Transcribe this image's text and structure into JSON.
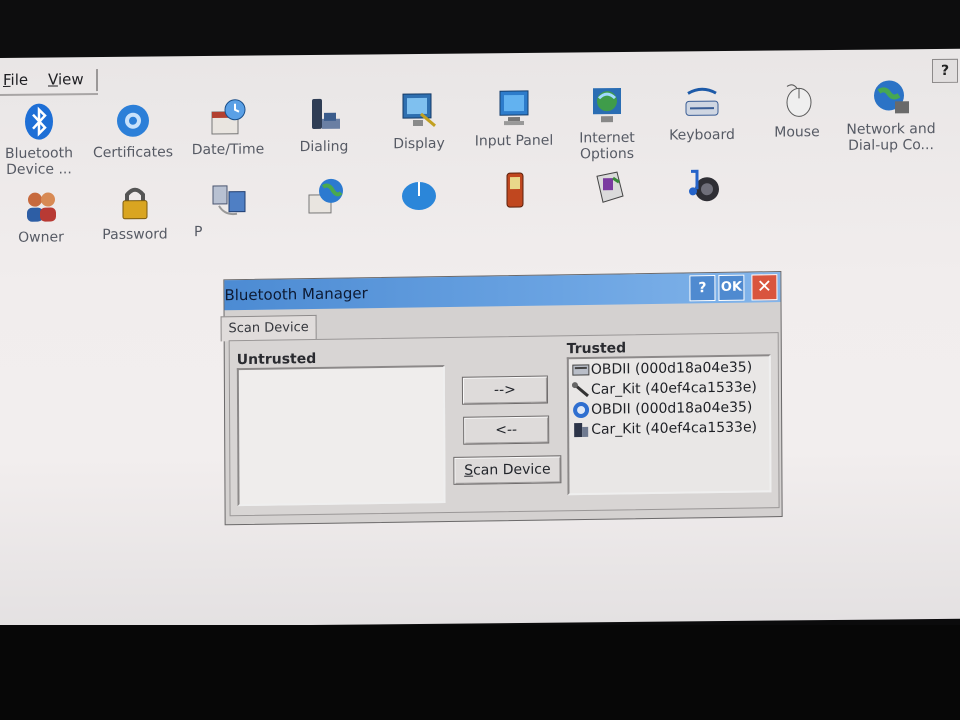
{
  "menubar": {
    "file": "File",
    "view": "View",
    "help_button": "?"
  },
  "control_panel": {
    "items": [
      {
        "name": "bluetooth",
        "label": "Bluetooth Device ...",
        "icon": "bluetooth-icon"
      },
      {
        "name": "certificates",
        "label": "Certificates",
        "icon": "certificates-icon"
      },
      {
        "name": "date-time",
        "label": "Date/Time",
        "icon": "date-time-icon"
      },
      {
        "name": "dialing",
        "label": "Dialing",
        "icon": "dialing-icon"
      },
      {
        "name": "display",
        "label": "Display",
        "icon": "display-icon"
      },
      {
        "name": "input-panel",
        "label": "Input Panel",
        "icon": "input-panel-icon"
      },
      {
        "name": "internet-options",
        "label": "Internet Options",
        "icon": "internet-options-icon"
      },
      {
        "name": "keyboard",
        "label": "Keyboard",
        "icon": "keyboard-icon"
      },
      {
        "name": "mouse",
        "label": "Mouse",
        "icon": "mouse-icon"
      },
      {
        "name": "network",
        "label": "Network and Dial-up Co...",
        "icon": "network-icon"
      },
      {
        "name": "owner",
        "label": "Owner",
        "icon": "owner-icon"
      },
      {
        "name": "password",
        "label": "Password",
        "icon": "password-icon"
      },
      {
        "name": "pc-connection",
        "label": "P",
        "icon": "pc-connection-icon"
      },
      {
        "name": "regional",
        "label": "",
        "icon": "regional-settings-icon"
      },
      {
        "name": "stylus",
        "label": "",
        "icon": "stylus-icon"
      },
      {
        "name": "system",
        "label": "",
        "icon": "system-icon"
      },
      {
        "name": "storage",
        "label": "",
        "icon": "storage-manager-icon"
      },
      {
        "name": "volume",
        "label": "",
        "icon": "volume-sounds-icon"
      }
    ]
  },
  "dialog": {
    "title": "Bluetooth Manager",
    "help": "?",
    "ok": "OK",
    "close": "✕",
    "tab": "Scan Device",
    "untrusted_label": "Untrusted",
    "trusted_label": "Trusted",
    "trusted_items": [
      {
        "label": "OBDII (000d18a04e35)",
        "icon": "serial-device-icon"
      },
      {
        "label": "Car_Kit (40ef4ca1533e)",
        "icon": "tools-icon"
      },
      {
        "label": "OBDII (000d18a04e35)",
        "icon": "bluetooth-device-icon"
      },
      {
        "label": "Car_Kit (40ef4ca1533e)",
        "icon": "phone-device-icon"
      }
    ],
    "buttons": {
      "move_right": "-->",
      "move_left": "<--",
      "scan_prefix": "S",
      "scan_rest": "can Device"
    }
  }
}
